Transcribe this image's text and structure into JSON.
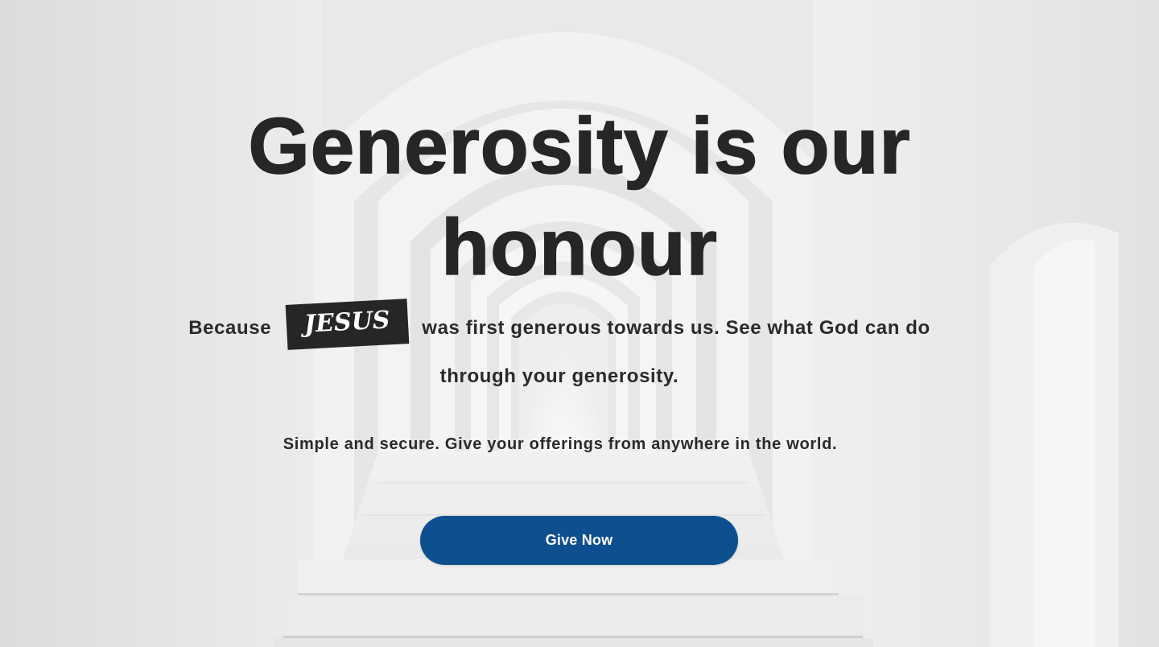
{
  "hero": {
    "headline_line1": "Generosity is our",
    "headline_line2": "honour",
    "subline_before": "Because",
    "subline_badge": "JESUS",
    "subline_after": "was first generous towards us. See what God can do through your generosity.",
    "tagline": "Simple and secure. Give your offerings from anywhere in the world.",
    "cta_label": "Give Now",
    "background_image": "white-arched-corridor-photo"
  },
  "colors": {
    "text": "#262626",
    "badge_bg": "#262626",
    "badge_text": "#ffffff",
    "button_bg": "#0d4f8f",
    "button_text": "#ffffff"
  }
}
